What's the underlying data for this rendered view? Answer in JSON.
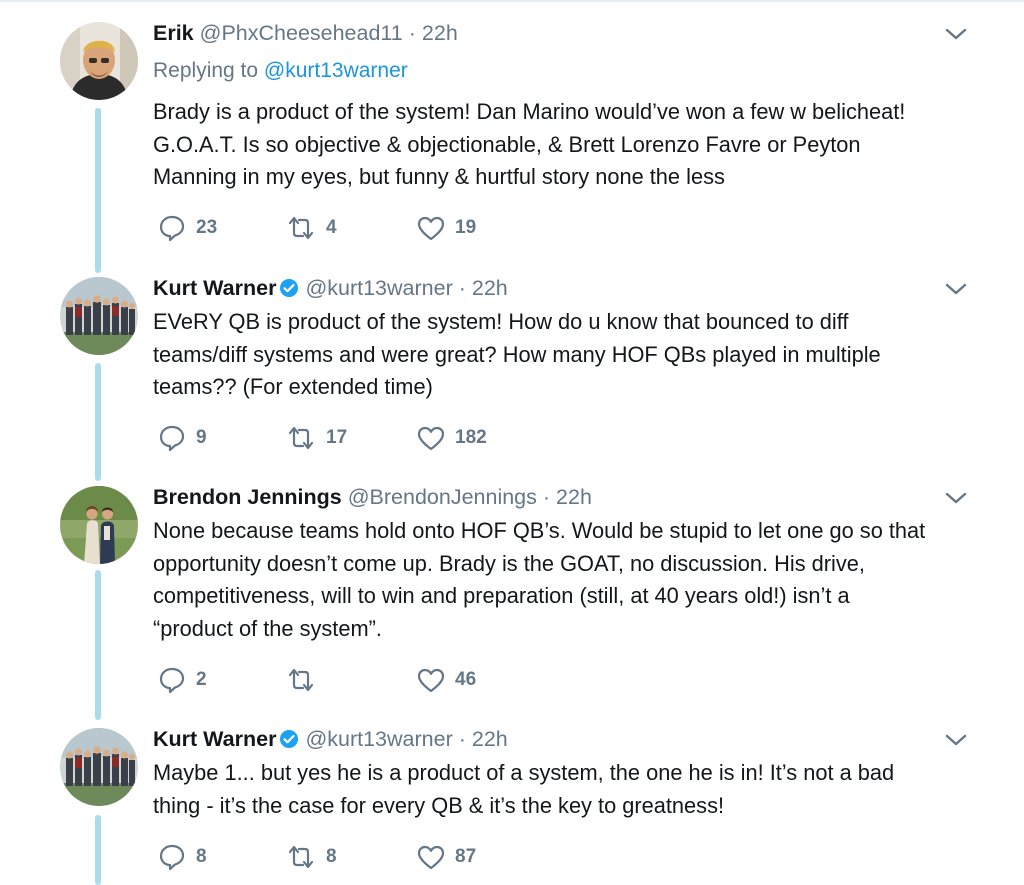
{
  "tweets": [
    {
      "name": "Erik",
      "handle": "@PhxCheesehead11",
      "dot": "·",
      "time": "22h",
      "verified": false,
      "replying_prefix": "Replying to",
      "replying_to": "@kurt13warner",
      "lines": [
        "Brady is a product of the system! Dan Marino would’ve won a few w belicheat!",
        "G.O.A.T. Is so objective & objectionable, & Brett Lorenzo Favre or Peyton",
        "Manning in my eyes, but funny & hurtful story none the less"
      ],
      "replies": "23",
      "retweets": "4",
      "likes": "19"
    },
    {
      "name": "Kurt Warner",
      "handle": "@kurt13warner",
      "dot": "·",
      "time": "22h",
      "verified": true,
      "lines": [
        "EVeRY QB is product of the system! How do u know that bounced to diff",
        "teams/diff systems and were great? How many HOF QBs played in multiple",
        "teams?? (For extended time)"
      ],
      "replies": "9",
      "retweets": "17",
      "likes": "182"
    },
    {
      "name": "Brendon Jennings",
      "handle": "@BrendonJennings",
      "dot": "·",
      "time": "22h",
      "verified": false,
      "lines": [
        "None because teams hold onto HOF QB’s. Would be stupid to let one go so that",
        "opportunity doesn’t come up. Brady is the GOAT, no discussion. His drive,",
        "competitiveness, will to win and preparation (still, at 40 years old!) isn’t a",
        "“product of the system”."
      ],
      "replies": "2",
      "retweets": "",
      "likes": "46"
    },
    {
      "name": "Kurt Warner",
      "handle": "@kurt13warner",
      "dot": "·",
      "time": "22h",
      "verified": true,
      "lines": [
        "Maybe 1... but yes he is a product of a system, the one he is in! It’s not a bad",
        "thing - it’s the case for every QB & it’s the key to greatness!"
      ],
      "replies": "8",
      "retweets": "8",
      "likes": "87"
    }
  ],
  "icons": {
    "reply": "reply-icon",
    "retweet": "retweet-icon",
    "like": "heart-icon",
    "menu": "chevron-down-icon",
    "verified": "verified-badge-icon"
  },
  "colors": {
    "text": "#14171a",
    "secondary": "#657786",
    "link": "#1b95e0",
    "thread_line": "#a9dcec",
    "verified": "#1da1f2"
  }
}
